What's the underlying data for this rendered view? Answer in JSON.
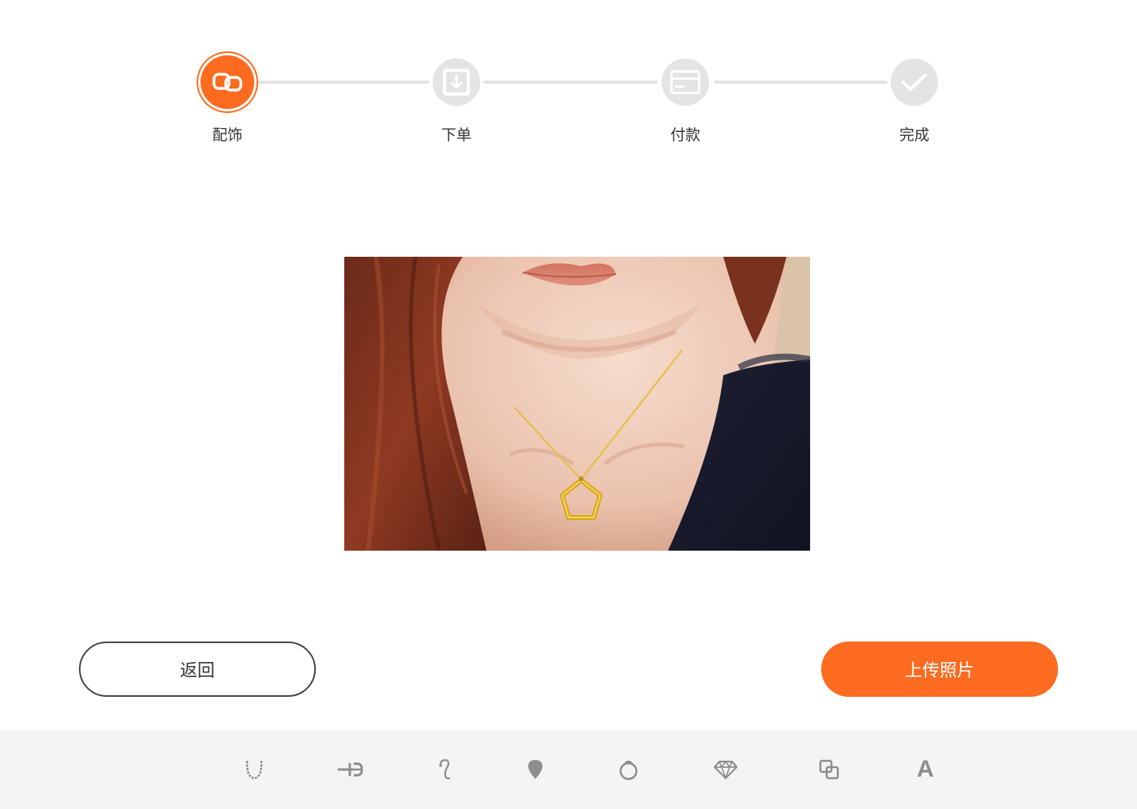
{
  "steps": [
    {
      "label": "配饰",
      "icon": "link-icon",
      "state": "active"
    },
    {
      "label": "下单",
      "icon": "download-box-icon",
      "state": "pending"
    },
    {
      "label": "付款",
      "icon": "card-icon",
      "state": "pending"
    },
    {
      "label": "完成",
      "icon": "check-icon",
      "state": "pending"
    }
  ],
  "colors": {
    "accent": "#fd6b21",
    "inactive": "#e4e4e4",
    "toolbar_bg": "#f4f4f4",
    "icon_gray": "#8d8d8d"
  },
  "preview": {
    "subject": "woman-wearing-pentagon-pendant-necklace"
  },
  "buttons": {
    "back_label": "返回",
    "upload_label": "上传照片"
  },
  "toolbar": {
    "tools": [
      {
        "icon": "necklace-chain-icon"
      },
      {
        "icon": "earring-stud-icon"
      },
      {
        "icon": "hook-earring-icon"
      },
      {
        "icon": "pendant-drop-icon"
      },
      {
        "icon": "ring-icon"
      },
      {
        "icon": "diamond-icon"
      },
      {
        "icon": "layers-icon"
      },
      {
        "icon": "text-icon",
        "letter": "A"
      }
    ]
  }
}
